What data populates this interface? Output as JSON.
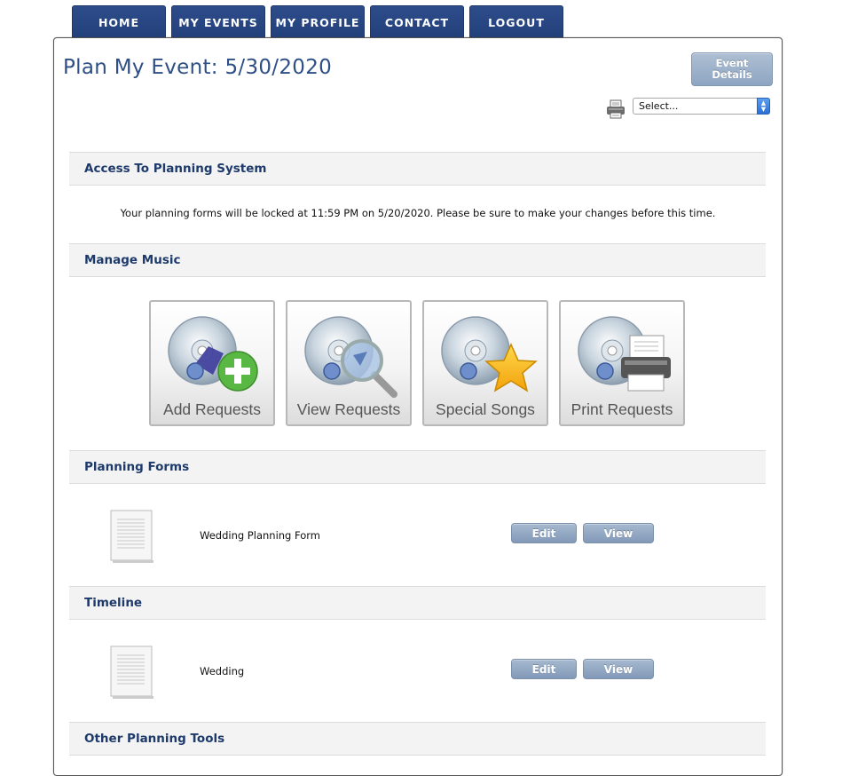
{
  "nav": {
    "tabs": [
      {
        "label": "HOME"
      },
      {
        "label": "MY EVENTS"
      },
      {
        "label": "MY PROFILE"
      },
      {
        "label": "CONTACT"
      },
      {
        "label": "LOGOUT"
      }
    ]
  },
  "header": {
    "title": "Plan My Event: 5/30/2020",
    "event_details_button": "Event Details",
    "select_value": "Select..."
  },
  "sections": {
    "access": {
      "title": "Access To Planning System",
      "text": "Your planning forms will be locked at 11:59 PM on 5/20/2020. Please be sure to make your changes before this time."
    },
    "music": {
      "title": "Manage Music",
      "buttons": [
        {
          "label": "Add Requests",
          "icon": "cd-add-icon"
        },
        {
          "label": "View Requests",
          "icon": "cd-magnifier-icon"
        },
        {
          "label": "Special Songs",
          "icon": "cd-star-icon"
        },
        {
          "label": "Print Requests",
          "icon": "cd-printer-icon"
        }
      ]
    },
    "planning_forms": {
      "title": "Planning Forms",
      "items": [
        {
          "name": "Wedding Planning Form",
          "edit": "Edit",
          "view": "View"
        }
      ]
    },
    "timeline": {
      "title": "Timeline",
      "items": [
        {
          "name": "Wedding",
          "edit": "Edit",
          "view": "View"
        }
      ]
    },
    "other_tools": {
      "title": "Other Planning Tools"
    }
  },
  "colors": {
    "nav_bg": "#2d4c8a",
    "title": "#2e4f86",
    "section_title": "#1d3a6b",
    "button_bg": "#8ea5c2"
  }
}
